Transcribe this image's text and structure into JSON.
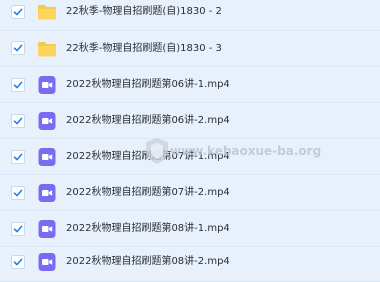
{
  "files": [
    {
      "name": "22秋季-物理自招刷题(自)1830 - 2",
      "type": "folder",
      "checked": true
    },
    {
      "name": "22秋季-物理自招刷题(自)1830 - 3",
      "type": "folder",
      "checked": true
    },
    {
      "name": "2022秋物理自招刷题第06讲-1.mp4",
      "type": "video",
      "checked": true
    },
    {
      "name": "2022秋物理自招刷题第06讲-2.mp4",
      "type": "video",
      "checked": true
    },
    {
      "name": "2022秋物理自招刷题第07讲-1.mp4",
      "type": "video",
      "checked": true
    },
    {
      "name": "2022秋物理自招刷题第07讲-2.mp4",
      "type": "video",
      "checked": true
    },
    {
      "name": "2022秋物理自招刷题第08讲-1.mp4",
      "type": "video",
      "checked": true
    },
    {
      "name": "2022秋物理自招刷题第08讲-2.mp4",
      "type": "video",
      "checked": true
    }
  ],
  "watermark": "www.kebaoxue-ba.org",
  "colors": {
    "check": "#1e7ff0",
    "folder": "#f7c948",
    "video": "#7a6cf0"
  }
}
